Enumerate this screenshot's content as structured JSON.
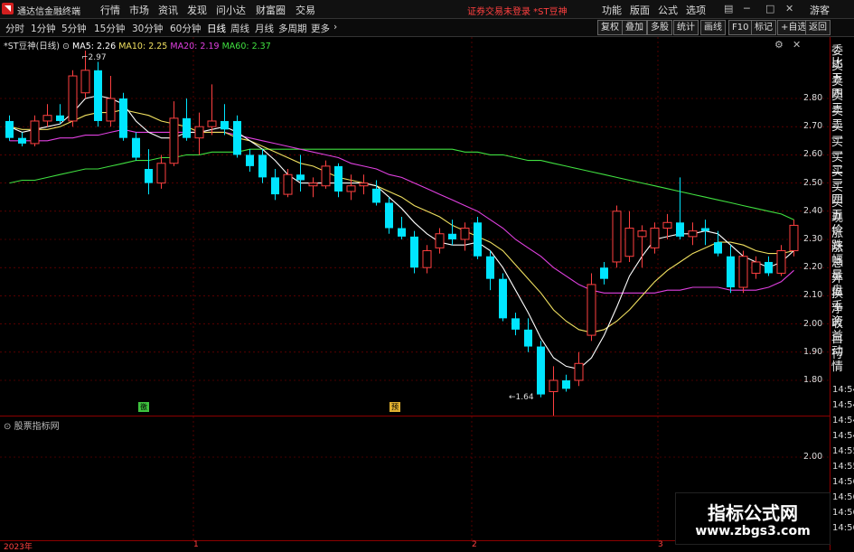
{
  "menubar": {
    "app_name": "通达信金融终端",
    "items": [
      "行情",
      "市场",
      "资讯",
      "发现",
      "问小达",
      "财富圈",
      "交易"
    ],
    "warning": "证券交易未登录 *ST豆神",
    "right_items": [
      "功能",
      "版面",
      "公式",
      "选项"
    ],
    "guest": "游客"
  },
  "toolbar": {
    "periods": [
      "分时",
      "1分钟",
      "5分钟",
      "15分钟",
      "30分钟",
      "60分钟",
      "日线",
      "周线",
      "月线",
      "多周期",
      "更多"
    ],
    "selected_period": "日线",
    "right_buttons": [
      "复权",
      "叠加",
      "多股",
      "统计",
      "画线",
      "F10",
      "标记",
      "+自选",
      "返回"
    ]
  },
  "chart_title": {
    "stock": "*ST豆神(日线)",
    "ma5": "MA5: 2.26",
    "ma10": "MA10: 2.25",
    "ma20": "MA20: 2.19",
    "ma60": "MA60: 2.37"
  },
  "panel2_title": "股票指标网",
  "right_panel": {
    "labels": [
      "委比",
      "卖五",
      "卖四",
      "卖三",
      "卖二",
      "卖一",
      "买一",
      "买二",
      "买三",
      "买四",
      "买五",
      "现价",
      "涨跌",
      "涨幅",
      "总量",
      "外盘",
      "换手",
      "净资",
      "收益",
      "自动",
      "行情"
    ],
    "times": [
      "14:54",
      "14:54",
      "14:54",
      "14:54",
      "14:55",
      "14:55",
      "14:56",
      "14:56",
      "14:56",
      "14:56"
    ]
  },
  "annotations": {
    "high": "2.97",
    "low": "1.64",
    "badge1": "徼",
    "badge2": "预"
  },
  "xaxis": {
    "labels": [
      "2023年",
      "1",
      "2",
      "3"
    ]
  },
  "watermark": {
    "line1": "指标公式网",
    "line2": "www.zbgs3.com"
  },
  "colors": {
    "up": "#ff4040",
    "down": "#00e5ff",
    "ma5": "#ffffff",
    "ma10": "#f0e060",
    "ma20": "#e040e0",
    "ma60": "#40e040",
    "grid": "#8b0000"
  },
  "chart_data": {
    "type": "candlestick",
    "ylim": [
      1.6,
      3.0
    ],
    "yticks": [
      1.8,
      1.9,
      2.0,
      2.1,
      2.2,
      2.3,
      2.4,
      2.5,
      2.6,
      2.7,
      2.8
    ],
    "panel2_yticks": [
      2.0
    ],
    "candles": [
      [
        2.72,
        2.74,
        2.65,
        2.66
      ],
      [
        2.66,
        2.68,
        2.63,
        2.64
      ],
      [
        2.64,
        2.74,
        2.63,
        2.72
      ],
      [
        2.72,
        2.78,
        2.7,
        2.74
      ],
      [
        2.74,
        2.78,
        2.71,
        2.72
      ],
      [
        2.72,
        2.9,
        2.7,
        2.88
      ],
      [
        2.82,
        2.97,
        2.8,
        2.9
      ],
      [
        2.9,
        2.93,
        2.7,
        2.72
      ],
      [
        2.72,
        2.88,
        2.7,
        2.8
      ],
      [
        2.8,
        2.82,
        2.65,
        2.66
      ],
      [
        2.66,
        2.68,
        2.58,
        2.59
      ],
      [
        2.55,
        2.62,
        2.46,
        2.5
      ],
      [
        2.5,
        2.6,
        2.48,
        2.57
      ],
      [
        2.57,
        2.79,
        2.56,
        2.73
      ],
      [
        2.73,
        2.8,
        2.65,
        2.66
      ],
      [
        2.66,
        2.75,
        2.6,
        2.7
      ],
      [
        2.7,
        2.85,
        2.67,
        2.72
      ],
      [
        2.72,
        2.78,
        2.67,
        2.69
      ],
      [
        2.72,
        2.74,
        2.59,
        2.6
      ],
      [
        2.6,
        2.62,
        2.54,
        2.56
      ],
      [
        2.6,
        2.62,
        2.5,
        2.52
      ],
      [
        2.52,
        2.55,
        2.44,
        2.46
      ],
      [
        2.46,
        2.55,
        2.45,
        2.53
      ],
      [
        2.53,
        2.6,
        2.47,
        2.51
      ],
      [
        2.49,
        2.52,
        2.45,
        2.5
      ],
      [
        2.49,
        2.58,
        2.48,
        2.56
      ],
      [
        2.56,
        2.57,
        2.45,
        2.47
      ],
      [
        2.47,
        2.53,
        2.44,
        2.49
      ],
      [
        2.49,
        2.53,
        2.46,
        2.5
      ],
      [
        2.48,
        2.51,
        2.42,
        2.43
      ],
      [
        2.43,
        2.45,
        2.32,
        2.34
      ],
      [
        2.34,
        2.38,
        2.3,
        2.31
      ],
      [
        2.31,
        2.33,
        2.18,
        2.2
      ],
      [
        2.2,
        2.28,
        2.18,
        2.26
      ],
      [
        2.27,
        2.34,
        2.25,
        2.32
      ],
      [
        2.32,
        2.37,
        2.28,
        2.3
      ],
      [
        2.3,
        2.36,
        2.26,
        2.34
      ],
      [
        2.36,
        2.38,
        2.23,
        2.24
      ],
      [
        2.24,
        2.26,
        2.12,
        2.16
      ],
      [
        2.16,
        2.18,
        2.01,
        2.02
      ],
      [
        2.02,
        2.04,
        1.96,
        1.98
      ],
      [
        1.98,
        2.02,
        1.9,
        1.92
      ],
      [
        1.92,
        1.94,
        1.74,
        1.75
      ],
      [
        1.76,
        1.85,
        1.64,
        1.8
      ],
      [
        1.8,
        1.82,
        1.76,
        1.77
      ],
      [
        1.8,
        1.9,
        1.78,
        1.86
      ],
      [
        1.96,
        2.18,
        1.94,
        2.14
      ],
      [
        2.2,
        2.22,
        2.14,
        2.16
      ],
      [
        2.22,
        2.42,
        2.2,
        2.4
      ],
      [
        2.24,
        2.4,
        2.22,
        2.34
      ],
      [
        2.31,
        2.35,
        2.2,
        2.33
      ],
      [
        2.27,
        2.36,
        2.25,
        2.34
      ],
      [
        2.34,
        2.39,
        2.3,
        2.36
      ],
      [
        2.36,
        2.52,
        2.3,
        2.31
      ],
      [
        2.31,
        2.36,
        2.28,
        2.33
      ],
      [
        2.34,
        2.37,
        2.28,
        2.33
      ],
      [
        2.29,
        2.33,
        2.24,
        2.25
      ],
      [
        2.24,
        2.28,
        2.11,
        2.13
      ],
      [
        2.13,
        2.26,
        2.11,
        2.24
      ],
      [
        2.18,
        2.24,
        2.16,
        2.22
      ],
      [
        2.22,
        2.24,
        2.17,
        2.18
      ],
      [
        2.18,
        2.28,
        2.17,
        2.26
      ],
      [
        2.26,
        2.37,
        2.24,
        2.35
      ]
    ],
    "ma5": [
      2.7,
      2.68,
      2.69,
      2.7,
      2.71,
      2.75,
      2.8,
      2.81,
      2.8,
      2.78,
      2.72,
      2.68,
      2.66,
      2.66,
      2.68,
      2.68,
      2.69,
      2.7,
      2.68,
      2.65,
      2.62,
      2.58,
      2.53,
      2.5,
      2.5,
      2.5,
      2.5,
      2.5,
      2.5,
      2.49,
      2.45,
      2.41,
      2.36,
      2.32,
      2.29,
      2.28,
      2.28,
      2.29,
      2.26,
      2.2,
      2.12,
      2.04,
      1.95,
      1.88,
      1.85,
      1.84,
      1.88,
      1.96,
      2.06,
      2.17,
      2.24,
      2.3,
      2.31,
      2.32,
      2.32,
      2.33,
      2.32,
      2.28,
      2.24,
      2.22,
      2.2,
      2.22,
      2.26
    ],
    "ma10": [
      2.7,
      2.69,
      2.69,
      2.69,
      2.7,
      2.72,
      2.74,
      2.75,
      2.75,
      2.76,
      2.75,
      2.74,
      2.72,
      2.71,
      2.7,
      2.68,
      2.68,
      2.68,
      2.66,
      2.65,
      2.63,
      2.61,
      2.59,
      2.57,
      2.56,
      2.54,
      2.52,
      2.51,
      2.5,
      2.49,
      2.47,
      2.45,
      2.42,
      2.4,
      2.38,
      2.35,
      2.33,
      2.31,
      2.29,
      2.26,
      2.21,
      2.16,
      2.11,
      2.05,
      2.01,
      1.98,
      1.97,
      1.98,
      2.01,
      2.05,
      2.1,
      2.15,
      2.19,
      2.22,
      2.25,
      2.27,
      2.29,
      2.29,
      2.28,
      2.26,
      2.25,
      2.25,
      2.26
    ],
    "ma20": [
      2.65,
      2.65,
      2.65,
      2.65,
      2.66,
      2.66,
      2.67,
      2.67,
      2.68,
      2.69,
      2.68,
      2.68,
      2.68,
      2.68,
      2.68,
      2.68,
      2.68,
      2.68,
      2.67,
      2.66,
      2.65,
      2.64,
      2.63,
      2.62,
      2.61,
      2.6,
      2.59,
      2.57,
      2.56,
      2.55,
      2.53,
      2.52,
      2.5,
      2.48,
      2.46,
      2.44,
      2.42,
      2.4,
      2.37,
      2.34,
      2.3,
      2.27,
      2.24,
      2.2,
      2.17,
      2.14,
      2.12,
      2.11,
      2.11,
      2.11,
      2.11,
      2.11,
      2.12,
      2.12,
      2.13,
      2.13,
      2.13,
      2.12,
      2.12,
      2.12,
      2.13,
      2.15,
      2.19
    ],
    "ma60": [
      2.5,
      2.51,
      2.51,
      2.52,
      2.53,
      2.54,
      2.55,
      2.55,
      2.56,
      2.57,
      2.58,
      2.58,
      2.59,
      2.59,
      2.6,
      2.6,
      2.61,
      2.61,
      2.61,
      2.62,
      2.62,
      2.62,
      2.62,
      2.62,
      2.62,
      2.62,
      2.62,
      2.62,
      2.62,
      2.62,
      2.62,
      2.62,
      2.62,
      2.62,
      2.62,
      2.62,
      2.61,
      2.61,
      2.6,
      2.6,
      2.59,
      2.58,
      2.58,
      2.57,
      2.56,
      2.55,
      2.54,
      2.53,
      2.52,
      2.51,
      2.5,
      2.49,
      2.48,
      2.47,
      2.46,
      2.45,
      2.44,
      2.43,
      2.42,
      2.41,
      2.4,
      2.39,
      2.37
    ]
  }
}
